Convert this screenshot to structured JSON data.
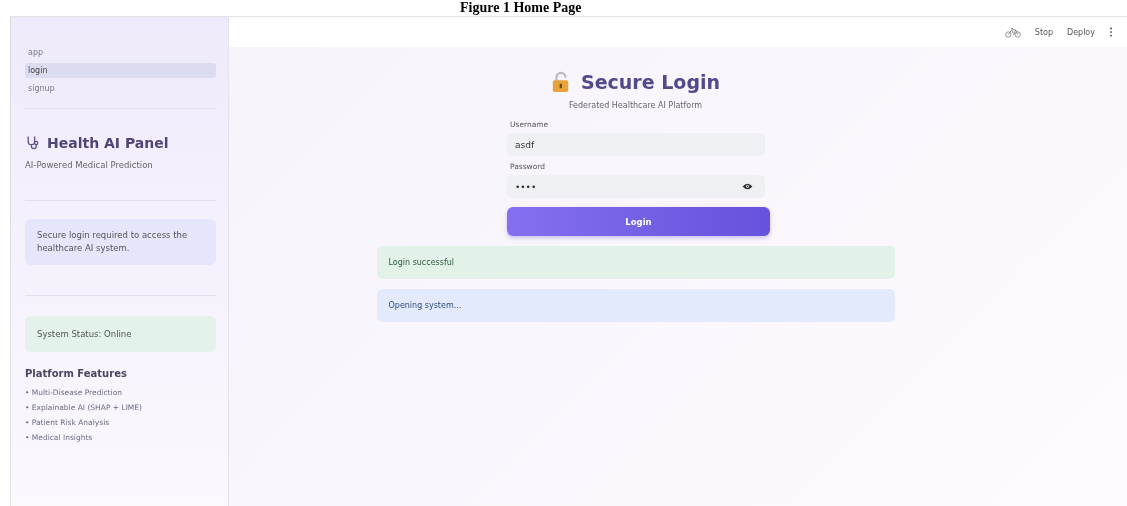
{
  "caption": "Figure 1 Home Page",
  "header": {
    "actions": [
      "Stop",
      "Deploy"
    ]
  },
  "sidebar": {
    "nav": [
      {
        "label": "app",
        "selected": false
      },
      {
        "label": "login",
        "selected": true
      },
      {
        "label": "signup",
        "selected": false
      }
    ],
    "title": "Health AI Panel",
    "subtitle": "AI-Powered Medical Prediction",
    "info": "Secure login required to access the healthcare AI system.",
    "status": "System Status: Online",
    "features_title": "Platform Features",
    "features": [
      "• Multi-Disease Prediction",
      "• Explainable AI (SHAP + LIME)",
      "• Patient Risk Analysis",
      "• Medical Insights"
    ]
  },
  "login": {
    "title": "Secure Login",
    "subtitle": "Federated Healthcare AI Platform",
    "fields": [
      {
        "label": "Username",
        "value": "asdf",
        "kind": "text"
      },
      {
        "label": "Password",
        "value": "••••",
        "kind": "password"
      }
    ],
    "button": "Login",
    "messages": [
      {
        "text": "Login successful",
        "kind": "success"
      },
      {
        "text": "Opening system...",
        "kind": "info"
      }
    ]
  }
}
